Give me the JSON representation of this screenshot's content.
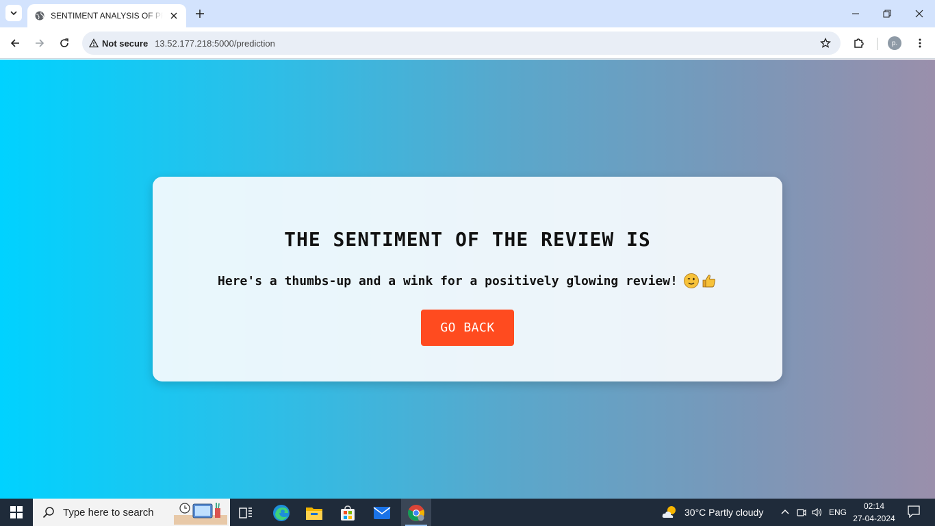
{
  "browser": {
    "tab_title": "SENTIMENT ANALYSIS OF PRODUCT REVIEWS",
    "security_label": "Not secure",
    "url": "13.52.177.218:5000/prediction",
    "profile_initial": "p."
  },
  "page": {
    "heading": "THE SENTIMENT OF THE REVIEW IS",
    "result_text": "Here's a thumbs-up and a wink for a positively glowing review!",
    "result_emojis": [
      "wink-emoji",
      "thumbs-up-emoji"
    ],
    "button_label": "GO BACK",
    "button_color": "#ff4b1f"
  },
  "taskbar": {
    "search_placeholder": "Type here to search",
    "weather": "30°C  Partly cloudy",
    "language": "ENG",
    "time": "02:14",
    "date": "27-04-2024"
  }
}
